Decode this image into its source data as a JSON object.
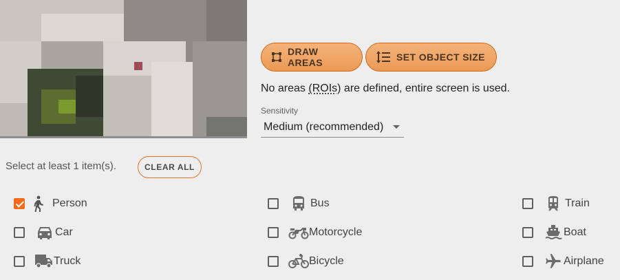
{
  "toolbar": {
    "draw_areas_label": "DRAW AREAS",
    "set_object_size_label": "SET OBJECT SIZE"
  },
  "roi": {
    "text_before": "No areas ",
    "abbr": "(ROIs)",
    "text_after": " are defined, entire screen is used."
  },
  "sensitivity": {
    "label": "Sensitivity",
    "value": "Medium (recommended)"
  },
  "objects": {
    "hint": "Select at least 1 item(s).",
    "clear_all_label": "CLEAR ALL",
    "items": [
      {
        "label": "Person",
        "icon": "person-walking-icon",
        "checked": true
      },
      {
        "label": "Bus",
        "icon": "bus-icon",
        "checked": false
      },
      {
        "label": "Train",
        "icon": "train-icon",
        "checked": false
      },
      {
        "label": "Car",
        "icon": "car-icon",
        "checked": false
      },
      {
        "label": "Motorcycle",
        "icon": "motorcycle-icon",
        "checked": false
      },
      {
        "label": "Boat",
        "icon": "boat-icon",
        "checked": false
      },
      {
        "label": "Truck",
        "icon": "truck-icon",
        "checked": false
      },
      {
        "label": "Bicycle",
        "icon": "bicycle-icon",
        "checked": false
      },
      {
        "label": "Airplane",
        "icon": "airplane-icon",
        "checked": false
      }
    ]
  },
  "colors": {
    "accent": "#f26b1d",
    "button_fill": "#eb9a55",
    "icon": "#6b6b6b"
  }
}
